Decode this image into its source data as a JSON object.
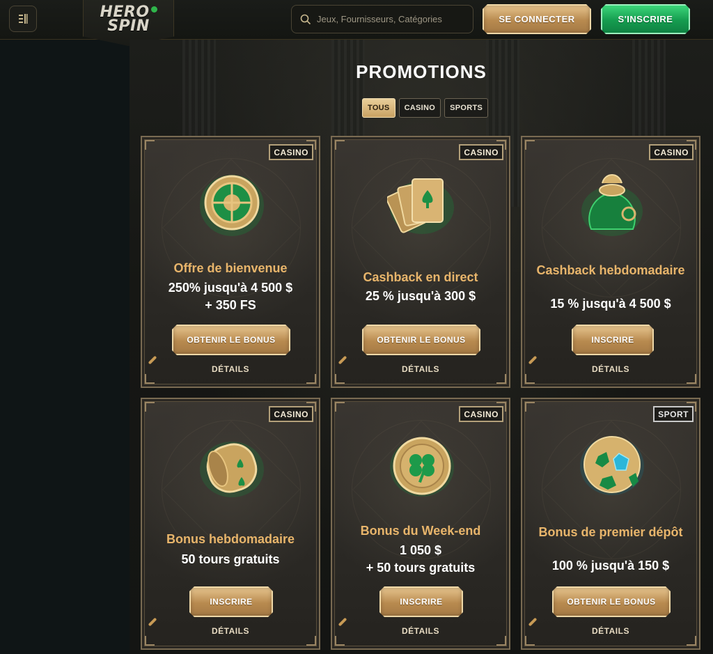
{
  "header": {
    "logo_line1": "HERO",
    "logo_line2": "SPIN",
    "search_placeholder": "Jeux, Fournisseurs, Catégories",
    "login_label": "SE CONNECTER",
    "signup_label": "S'INSCRIRE"
  },
  "page": {
    "title": "PROMOTIONS",
    "filters": [
      "TOUS",
      "CASINO",
      "SPORTS"
    ],
    "active_filter": "TOUS"
  },
  "cards": [
    {
      "badge": "CASINO",
      "art": "roulette-icon",
      "title": "Offre de bienvenue",
      "offer_line1": "250% jusqu'à 4 500 $",
      "offer_line2": "+ 350 FS",
      "button": "OBTENIR LE BONUS",
      "details": "DÉTAILS"
    },
    {
      "badge": "CASINO",
      "art": "cards-icon",
      "title": "Cashback en direct",
      "offer_line1": "25 % jusqu'à 300 $",
      "offer_line2": "",
      "button": "OBTENIR LE BONUS",
      "details": "DÉTAILS"
    },
    {
      "badge": "CASINO",
      "art": "money-bag-icon",
      "title": "Cashback hebdomadaire",
      "offer_line1": "15 % jusqu'à 4 500 $",
      "offer_line2": "",
      "button": "INSCRIRE",
      "details": "DÉTAILS"
    },
    {
      "badge": "CASINO",
      "art": "slot-reel-icon",
      "title": "Bonus hebdomadaire",
      "offer_line1": "50 tours gratuits",
      "offer_line2": "",
      "button": "INSCRIRE",
      "details": "DÉTAILS"
    },
    {
      "badge": "CASINO",
      "art": "clover-coin-icon",
      "title": "Bonus du Week-end",
      "offer_line1": "1 050 $",
      "offer_line2": "+ 50 tours gratuits",
      "button": "INSCRIRE",
      "details": "DÉTAILS"
    },
    {
      "badge": "SPORT",
      "art": "soccer-ball-icon",
      "title": "Bonus de premier dépôt",
      "offer_line1": "100 % jusqu'à 150 $",
      "offer_line2": "",
      "button": "OBTENIR LE BONUS",
      "details": "DÉTAILS"
    }
  ],
  "colors": {
    "gold_accent": "#e8b56b",
    "green_button": "#159c4f",
    "card_border": "#7a6b52",
    "page_bg": "#0f1516"
  }
}
